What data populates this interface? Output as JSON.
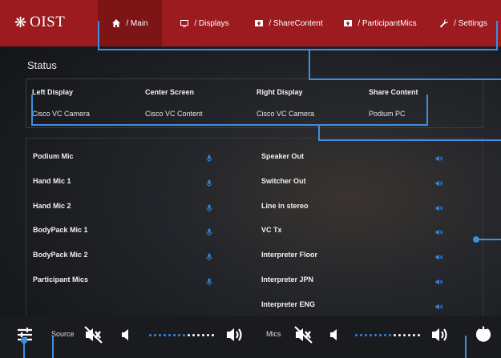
{
  "brand": {
    "logo_text": "OIST"
  },
  "nav": {
    "tabs": [
      {
        "label": "/ Main",
        "icon": "home-icon",
        "active": true
      },
      {
        "label": "/ Displays",
        "icon": "display-icon",
        "active": false
      },
      {
        "label": "/ ShareContent",
        "icon": "share-icon",
        "active": false
      },
      {
        "label": "/ ParticipantMics",
        "icon": "participant-mic-icon",
        "active": false
      },
      {
        "label": "/ Settings",
        "icon": "wrench-icon",
        "active": false
      }
    ]
  },
  "status": {
    "title": "Status",
    "columns": [
      {
        "header": "Left Display",
        "value": "Cisco VC Camera"
      },
      {
        "header": "Center Screen",
        "value": "Cisco VC Content"
      },
      {
        "header": "Right Display",
        "value": "Cisco VC Camera"
      },
      {
        "header": "Share Content",
        "value": "Podium PC"
      }
    ]
  },
  "mics": [
    "Podium Mic",
    "Hand Mic 1",
    "Hand Mic 2",
    "BodyPack Mic 1",
    "BodyPack Mic 2",
    "Participant Mics"
  ],
  "outputs": [
    "Speaker Out",
    "Switcher Out",
    "Line in stereo",
    "VC Tx",
    "Interpreter Floor",
    "Interpreter JPN",
    "Interpreter ENG"
  ],
  "bottom": {
    "source_label": "Source",
    "mics_label": "Mics",
    "source_volume": 0.6,
    "mics_volume": 0.6
  },
  "colors": {
    "brand_red": "#9b1b1f",
    "active_tab": "#7d1416",
    "accent_blue": "#2e86e0"
  }
}
